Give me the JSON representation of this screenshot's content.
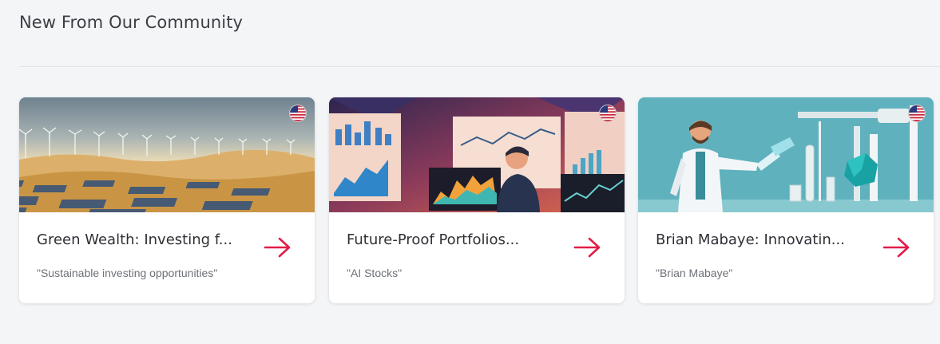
{
  "section": {
    "title": "New From Our Community"
  },
  "cards": [
    {
      "title": "Green Wealth: Investing f...",
      "subtitle": "\"Sustainable investing opportunities\"",
      "image": "wind-farm-solar-desert-image",
      "flag": "us-flag-icon"
    },
    {
      "title": "Future-Proof Portfolios...",
      "subtitle": "\"AI Stocks\"",
      "image": "trader-with-charts-image",
      "flag": "us-flag-icon"
    },
    {
      "title": "Brian Mabaye: Innovatin...",
      "subtitle": "\"Brian Mabaye\"",
      "image": "scientist-lab-image",
      "flag": "us-flag-icon"
    }
  ],
  "colors": {
    "accent": "#e11d48",
    "background": "#f4f5f7",
    "card": "#ffffff"
  }
}
